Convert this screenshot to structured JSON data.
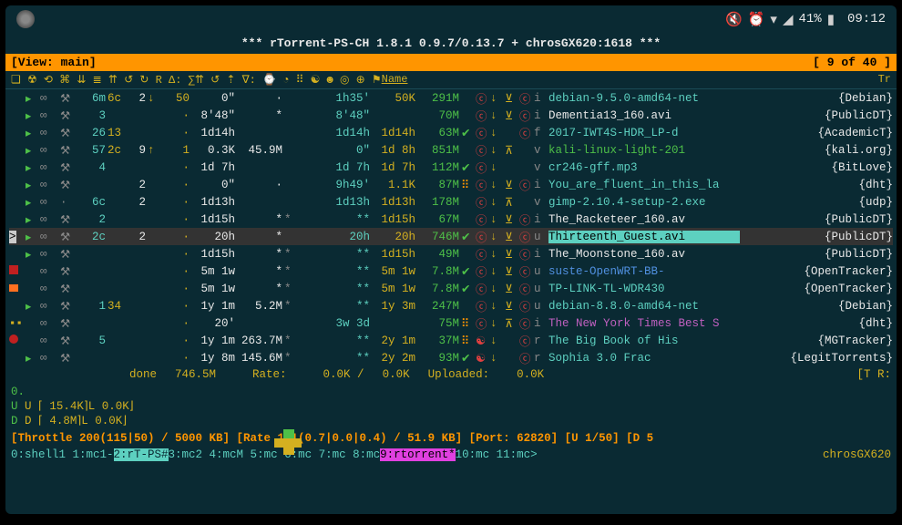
{
  "statusbar": {
    "battery": "41%",
    "time": "09:12"
  },
  "title": "***  rTorrent-PS-CH 1.8.1 0.9.7/0.13.7 + chrosGX620:1618 ***",
  "view": {
    "label": "[View: main]",
    "pager": "[    9 of 40   ]"
  },
  "header": {
    "name": "Name",
    "tr": "Tr"
  },
  "rows": [
    {
      "mk": "",
      "st": "▸",
      "inf": "∞",
      "pk": "⚒",
      "r": "6m",
      "ch": "6c",
      "p": "2",
      "arr": "↓",
      "pr": "50",
      "up": "0″",
      "dot": "·",
      "eta": "1h35′",
      "rate": "50K",
      "size": "291M",
      "fl": "",
      "s1": "ⓒ",
      "s2": "↓",
      "s3": "⊻",
      "s4": "ⓒ",
      "s5": "i",
      "name": "debian-9.5.0-amd64-net",
      "tracker": "{Debian}",
      "nc": "c-cyan"
    },
    {
      "mk": "",
      "st": "▸",
      "inf": "∞",
      "pk": "⚒",
      "r": "3",
      "ch": "",
      "p": "",
      "arr": "",
      "pr": "·",
      "up": "8′48″",
      "dot": "*",
      "eta": "8′48″",
      "rate": "",
      "size": "70M",
      "fl": "",
      "s1": "ⓒ",
      "s2": "↓",
      "s3": "⊻",
      "s4": "ⓒ",
      "s5": "i",
      "name": "Dementia13_160.avi",
      "tracker": "{PublicDT}",
      "nc": "c-white"
    },
    {
      "mk": "",
      "st": "▸",
      "inf": "∞",
      "pk": "⚒",
      "r": "26",
      "ch": "13",
      "p": "",
      "arr": "",
      "pr": "·",
      "up": "1d14h",
      "dot": "",
      "eta": "1d14h",
      "rate": "1d14h",
      "size": "63M",
      "fl": "✔",
      "s1": "ⓒ",
      "s2": "↓",
      "s3": "",
      "s4": "ⓒ",
      "s5": "f",
      "name": "2017-IWT4S-HDR_LP-d",
      "tracker": "{AcademicT}",
      "nc": "c-cyan"
    },
    {
      "mk": "",
      "st": "▸",
      "inf": "∞",
      "pk": "⚒",
      "r": "57",
      "ch": "2c",
      "p": "9",
      "arr": "↑",
      "pr": "1",
      "up": "0.3K",
      "dot": "45.9M",
      "eta": "0″",
      "rate": "1d 8h",
      "size": "851M",
      "fl": "",
      "s1": "ⓒ",
      "s2": "↓",
      "s3": "⊼",
      "s4": "",
      "s5": "v",
      "name": "kali-linux-light-201",
      "tracker": "{kali.org}",
      "nc": "c-green"
    },
    {
      "mk": "",
      "st": "▸",
      "inf": "∞",
      "pk": "⚒",
      "r": "4",
      "ch": "",
      "p": "",
      "arr": "",
      "pr": "·",
      "up": "1d 7h",
      "dot": "",
      "eta": "1d 7h",
      "rate": "1d 7h",
      "size": "112M",
      "fl": "✔",
      "s1": "ⓒ",
      "s2": "↓",
      "s3": "",
      "s4": "",
      "s5": "v",
      "name": "cr246-gff.mp3",
      "tracker": "{BitLove}",
      "nc": "c-cyan"
    },
    {
      "mk": "",
      "st": "▸",
      "inf": "∞",
      "pk": "⚒",
      "r": "",
      "ch": "",
      "p": "2",
      "arr": "",
      "pr": "·",
      "up": "0″",
      "dot": "·",
      "eta": "9h49′",
      "rate": "1.1K",
      "size": "87M",
      "fl": "⠿",
      "s1": "ⓒ",
      "s2": "↓",
      "s3": "⊻",
      "s4": "ⓒ",
      "s5": "i",
      "name": "You_are_fluent_in_this_la",
      "tracker": "{dht}",
      "nc": "c-cyan"
    },
    {
      "mk": "",
      "st": "▸",
      "inf": "∞",
      "pk": "·",
      "r": "6c",
      "ch": "",
      "p": "2",
      "arr": "",
      "pr": "·",
      "up": "1d13h",
      "dot": "",
      "eta": "1d13h",
      "rate": "1d13h",
      "size": "178M",
      "fl": "",
      "s1": "ⓒ",
      "s2": "↓",
      "s3": "⊼",
      "s4": "",
      "s5": "v",
      "name": "gimp-2.10.4-setup-2.exe",
      "tracker": "{udp}",
      "nc": "c-cyan"
    },
    {
      "mk": "",
      "st": "▸",
      "inf": "∞",
      "pk": "⚒",
      "r": "2",
      "ch": "",
      "p": "",
      "arr": "",
      "pr": "·",
      "up": "1d15h",
      "dot": "*",
      "eta": "**",
      "rate": "1d15h",
      "size": "67M",
      "fl": "",
      "s1": "ⓒ",
      "s2": "↓",
      "s3": "⊻",
      "s4": "ⓒ",
      "s5": "i",
      "name": "The_Racketeer_160.av",
      "tracker": "{PublicDT}",
      "nc": "c-white"
    },
    {
      "mk": ">",
      "st": "▸",
      "inf": "∞",
      "pk": "⚒",
      "r": "2c",
      "ch": "",
      "p": "2",
      "arr": "",
      "pr": "·",
      "up": "20h",
      "dot": "*",
      "eta": "20h",
      "rate": "20h",
      "size": "746M",
      "fl": "✔",
      "s1": "ⓒ",
      "s2": "↓",
      "s3": "⊻",
      "s4": "ⓒ",
      "s5": "u",
      "name": "Thirteenth_Guest.avi",
      "tracker": "{PublicDT}",
      "nc": "name-hl",
      "sel": true
    },
    {
      "mk": "",
      "st": "▸",
      "inf": "∞",
      "pk": "⚒",
      "r": "",
      "ch": "",
      "p": "",
      "arr": "",
      "pr": "·",
      "up": "1d15h",
      "dot": "*",
      "eta": "**",
      "rate": "1d15h",
      "size": "49M",
      "fl": "",
      "s1": "ⓒ",
      "s2": "↓",
      "s3": "⊻",
      "s4": "ⓒ",
      "s5": "i",
      "name": "The_Moonstone_160.av",
      "tracker": "{PublicDT}",
      "nc": "c-white"
    },
    {
      "mk": "▪",
      "st": "",
      "inf": "∞",
      "pk": "⚒",
      "r": "",
      "ch": "",
      "p": "",
      "arr": "",
      "pr": "·",
      "up": "5m 1w",
      "dot": "*",
      "eta": "**",
      "rate": "5m 1w",
      "size": "7.8M",
      "fl": "✔",
      "s1": "ⓒ",
      "s2": "↓",
      "s3": "⊻",
      "s4": "ⓒ",
      "s5": "u",
      "name": "suste-OpenWRT-BB-",
      "tracker": "{OpenTracker}",
      "nc": "c-blue"
    },
    {
      "mk": "▪",
      "st": "",
      "inf": "∞",
      "pk": "⚒",
      "r": "",
      "ch": "",
      "p": "",
      "arr": "",
      "pr": "·",
      "up": "5m 1w",
      "dot": "*",
      "eta": "**",
      "rate": "5m 1w",
      "size": "7.8M",
      "fl": "✔",
      "s1": "ⓒ",
      "s2": "↓",
      "s3": "⊻",
      "s4": "ⓒ",
      "s5": "u",
      "name": "TP-LINK-TL-WDR430",
      "tracker": "{OpenTracker}",
      "nc": "c-cyan",
      "mkc": "c-orange"
    },
    {
      "mk": "",
      "st": "▸",
      "inf": "∞",
      "pk": "⚒",
      "r": "1",
      "ch": "34",
      "p": "",
      "arr": "",
      "pr": "·",
      "up": "1y 1m",
      "dot": "5.2M",
      "eta": "**",
      "rate": "1y 3m",
      "size": "247M",
      "fl": "",
      "s1": "ⓒ",
      "s2": "↓",
      "s3": "⊻",
      "s4": "ⓒ",
      "s5": "u",
      "name": "debian-8.8.0-amd64-net",
      "tracker": "{Debian}",
      "nc": "c-cyan"
    },
    {
      "mk": "--",
      "st": "",
      "inf": "∞",
      "pk": "⚒",
      "r": "",
      "ch": "",
      "p": "",
      "arr": "",
      "pr": "·",
      "up": "20′",
      "dot": "",
      "eta": "3w 3d",
      "rate": "",
      "size": "75M",
      "fl": "⠿",
      "s1": "ⓒ",
      "s2": "↓",
      "s3": "⊼",
      "s4": "ⓒ",
      "s5": "i",
      "name": "The New York Times Best S",
      "tracker": "{dht}",
      "nc": "c-magenta",
      "mkc": "marker-yellow"
    },
    {
      "mk": "◉",
      "st": "",
      "inf": "∞",
      "pk": "⚒",
      "r": "5",
      "ch": "",
      "p": "",
      "arr": "",
      "pr": "·",
      "up": "1y 1m",
      "dot": "263.7M",
      "eta": "**",
      "rate": "2y 1m",
      "size": "37M",
      "fl": "⠿",
      "s1": "☯",
      "s2": "↓",
      "s3": "",
      "s4": "ⓒ",
      "s5": "r",
      "name": "The Big Book of His",
      "tracker": "{MGTracker}",
      "nc": "c-cyan",
      "mkc": "marker-red"
    },
    {
      "mk": "",
      "st": "▸",
      "inf": "∞",
      "pk": "⚒",
      "r": "",
      "ch": "",
      "p": "",
      "arr": "",
      "pr": "·",
      "up": "1y 8m",
      "dot": "145.6M",
      "eta": "**",
      "rate": "2y 2m",
      "size": "93M",
      "fl": "✔",
      "s1": "☯",
      "s2": "↓",
      "s3": "",
      "s4": "ⓒ",
      "s5": "r",
      "name": "Sophia 3.0 Frac",
      "tracker": "{LegitTorrents}",
      "nc": "c-cyan"
    }
  ],
  "footer": {
    "done_label": "done",
    "done_val": "746.5M",
    "rate_label": "Rate:",
    "rate_v1": "0.0K /",
    "rate_v2": "0.0K",
    "up_label": "Uploaded:",
    "up_val": "0.0K",
    "tr": "[T   R:"
  },
  "ud": {
    "zero": "0.",
    "u_line": "U ⌈ 15.4K⌉L   0.0K⌋",
    "d_line": "D ⌈  4.8M⌉L   0.0K⌋"
  },
  "throttle": "[Throttle 200(115|50) / 5000 KB] [Rate   1.1(0.7|0.0|0.4) /   51.9 KB] [Port: 62820] [U 1/50] [D 5",
  "tmux": {
    "t0": "0:shell1  1:mc1- ",
    "t1": "2:rT-PS#",
    "t2": " 3:mc2  4:mcM 5:mc  6:mc  7:mc  8:mc  ",
    "t3": "9:rtorrent*",
    "t4": " 10:mc  11:mc>",
    "host": "chrosGX620"
  }
}
